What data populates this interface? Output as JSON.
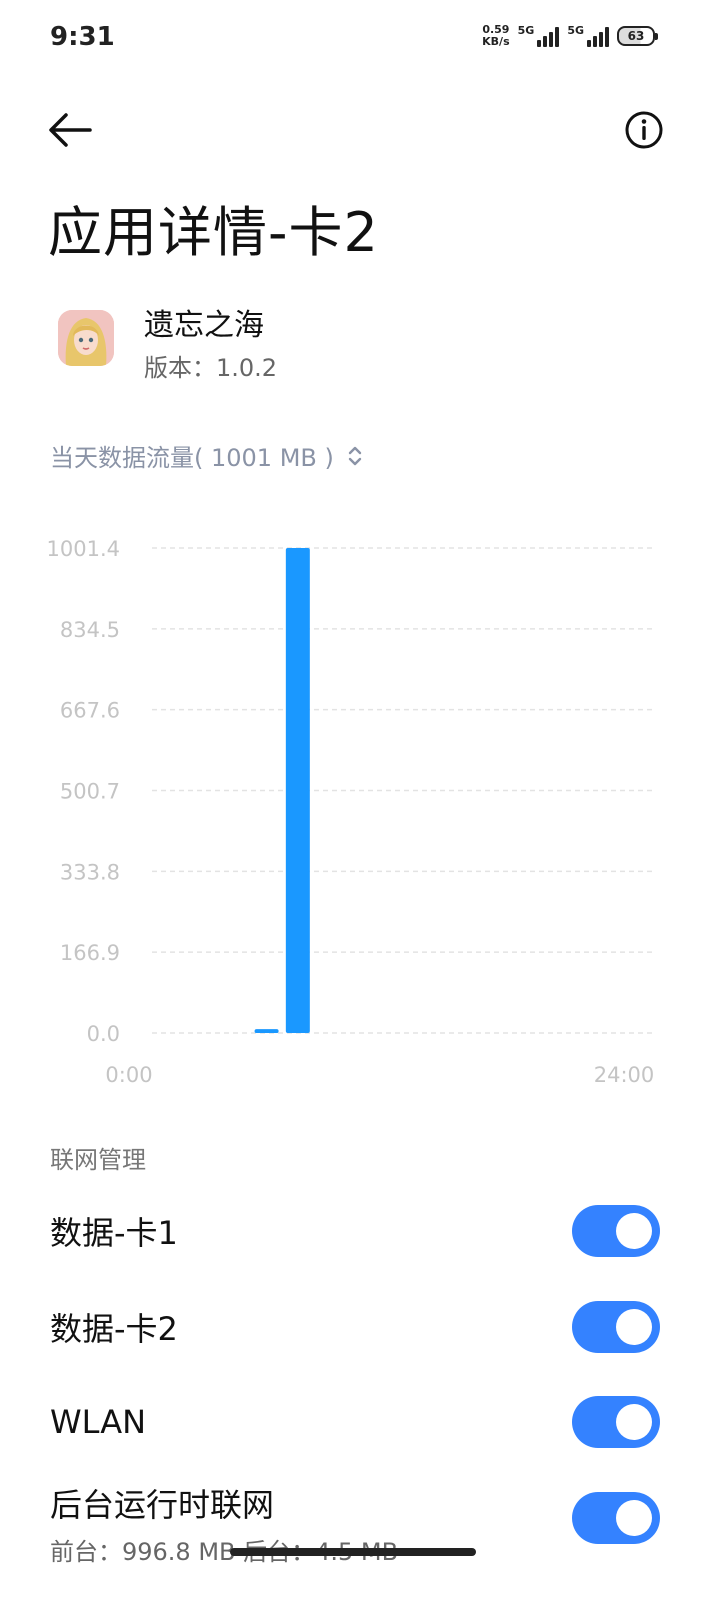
{
  "status_bar": {
    "time": "9:31",
    "speed_value": "0.59",
    "speed_unit": "KB/s",
    "network1_label": "5G",
    "network2_label": "5G",
    "battery_level": "63"
  },
  "header": {
    "back_icon": "arrow-left-icon",
    "info_icon": "info-circle-icon",
    "title": "应用详情-卡2"
  },
  "app": {
    "name": "遗忘之海",
    "version": "版本：1.0.2"
  },
  "traffic": {
    "label": "当天数据流量( 1001 MB )",
    "selector_icon": "chevron-updown-icon"
  },
  "chart_data": {
    "type": "bar",
    "x_start_label": "0:00",
    "x_end_label": "24:00",
    "x_range": [
      0,
      24
    ],
    "ylim": [
      0,
      1001.4
    ],
    "y_ticks": [
      "1001.4",
      "834.5",
      "667.6",
      "500.7",
      "333.8",
      "166.9",
      "0.0"
    ],
    "grid": true,
    "bars": [
      {
        "hour": 5.5,
        "value": 8
      },
      {
        "hour": 7.0,
        "value": 1001.4
      }
    ],
    "colors": {
      "bar": "#1a98ff",
      "grid": "#e3e3e3",
      "tick_text": "#c4c4c4"
    }
  },
  "network_management": {
    "title": "联网管理",
    "items": [
      {
        "label": "数据-卡1",
        "enabled": true
      },
      {
        "label": "数据-卡2",
        "enabled": true
      },
      {
        "label": "WLAN",
        "enabled": true
      },
      {
        "label": "后台运行时联网",
        "sub": "前台：996.8 MB  后台：4.5 MB",
        "enabled": true
      }
    ]
  },
  "colors": {
    "accent": "#3482ff"
  }
}
